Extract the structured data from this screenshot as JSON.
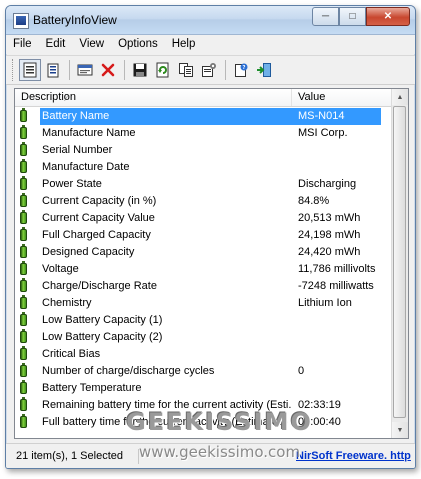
{
  "window": {
    "title": "BatteryInfoView"
  },
  "menu": [
    "File",
    "Edit",
    "View",
    "Options",
    "Help"
  ],
  "list": {
    "columns": {
      "description": "Description",
      "value": "Value"
    },
    "rows": [
      {
        "description": "Battery Name",
        "value": "MS-N014",
        "selected": true
      },
      {
        "description": "Manufacture Name",
        "value": "MSI Corp."
      },
      {
        "description": "Serial Number",
        "value": ""
      },
      {
        "description": "Manufacture Date",
        "value": ""
      },
      {
        "description": "Power State",
        "value": "Discharging"
      },
      {
        "description": "Current Capacity (in %)",
        "value": "84.8%"
      },
      {
        "description": "Current Capacity Value",
        "value": "20,513 mWh"
      },
      {
        "description": "Full Charged Capacity",
        "value": "24,198 mWh"
      },
      {
        "description": "Designed Capacity",
        "value": "24,420 mWh"
      },
      {
        "description": "Voltage",
        "value": "11,786 millivolts"
      },
      {
        "description": "Charge/Discharge Rate",
        "value": "-7248 milliwatts"
      },
      {
        "description": "Chemistry",
        "value": "Lithium Ion"
      },
      {
        "description": "Low Battery Capacity (1)",
        "value": ""
      },
      {
        "description": "Low Battery Capacity (2)",
        "value": ""
      },
      {
        "description": "Critical Bias",
        "value": ""
      },
      {
        "description": "Number of charge/discharge cycles",
        "value": "0"
      },
      {
        "description": "Battery Temperature",
        "value": ""
      },
      {
        "description": "Remaining battery time for the current activity (Esti...",
        "value": "02:33:19"
      },
      {
        "description": "Full battery time for the current activity (Estimated)",
        "value": "03:00:40"
      }
    ]
  },
  "status": {
    "items": "21 item(s), 1 Selected",
    "credit": "NirSoft Freeware.  http"
  },
  "watermark": {
    "logo": "GEEKISSIMO",
    "url": "www.geekissimo.com"
  },
  "colors": {
    "selection": "#3399ff",
    "credit": "#0033cc",
    "title_bar": "#c6d9ef"
  },
  "icons": [
    "app-icon",
    "battery-icon",
    "properties-icon",
    "list-icon",
    "html-report-icon",
    "delete-icon",
    "save-icon",
    "refresh-icon",
    "copy-icon",
    "advanced-options-icon",
    "about-icon",
    "exit-icon"
  ]
}
